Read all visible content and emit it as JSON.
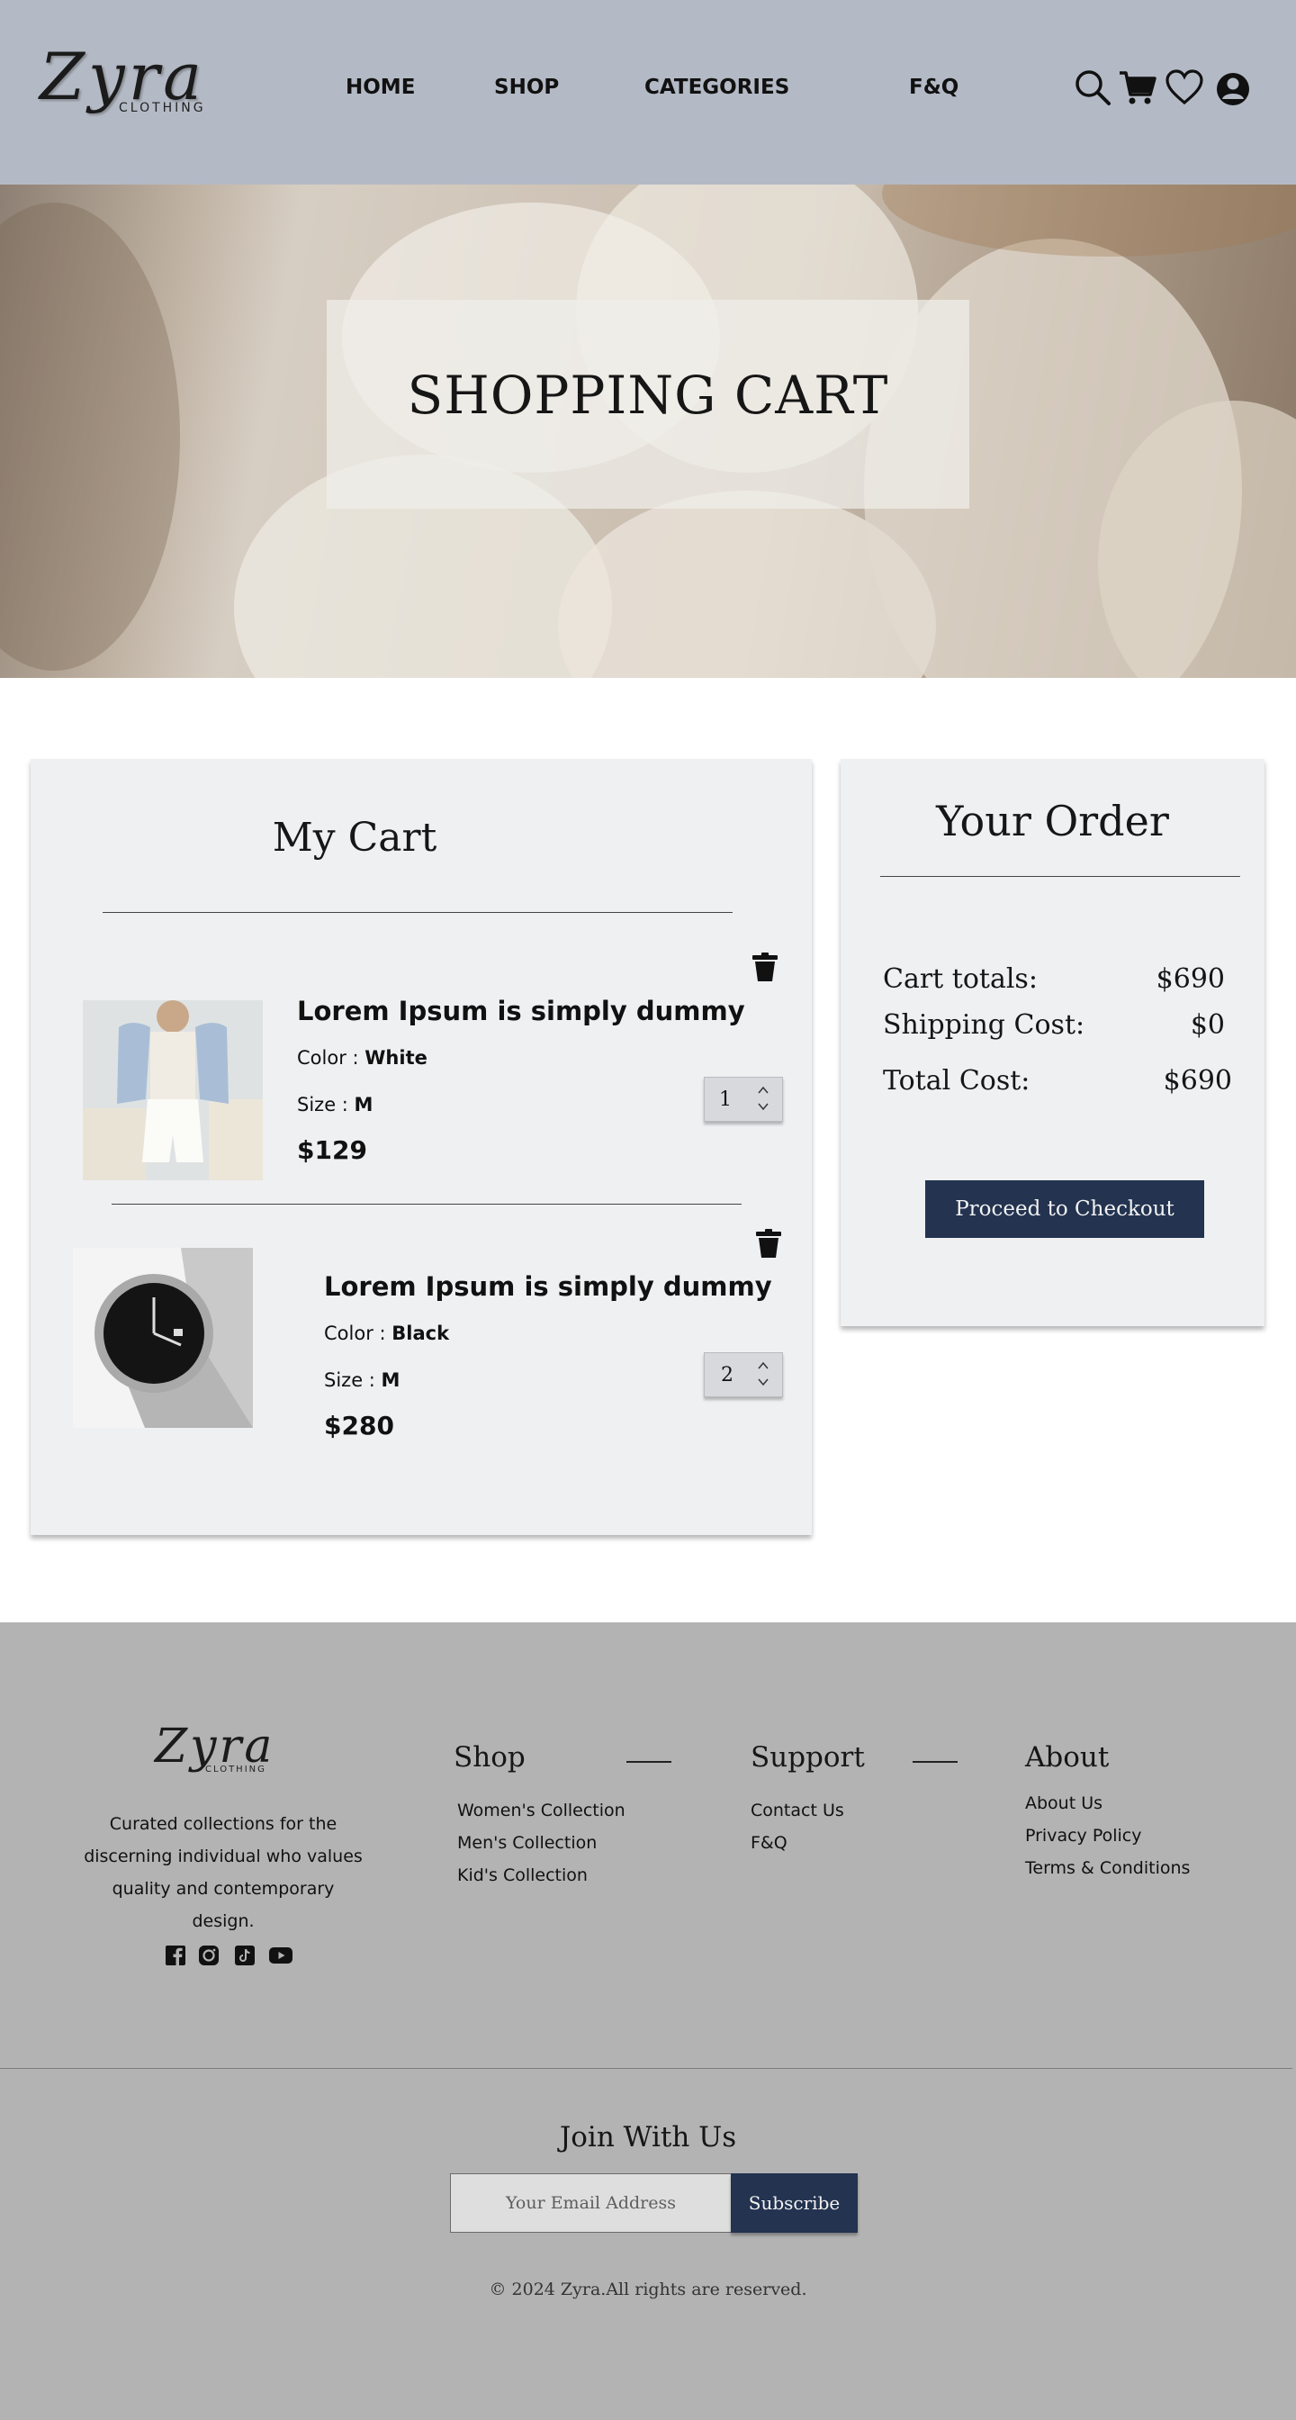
{
  "header": {
    "logo_script": "Zyra",
    "logo_sub": "CLOTHING",
    "nav": [
      "HOME",
      "SHOP",
      "CATEGORIES",
      "F&Q"
    ],
    "icons": [
      "search-icon",
      "cart-icon",
      "heart-icon",
      "user-icon"
    ]
  },
  "hero": {
    "title": "SHOPPING CART"
  },
  "cart": {
    "title": "My Cart",
    "items": [
      {
        "name": "Lorem Ipsum is simply dummy",
        "color_label": "Color : ",
        "color": "White",
        "size_label": "Size : ",
        "size": "M",
        "price": "$129",
        "qty": "1"
      },
      {
        "name": "Lorem Ipsum is simply dummy",
        "color_label": "Color : ",
        "color": "Black",
        "size_label": "Size : ",
        "size": "M",
        "price": "$280",
        "qty": "2"
      }
    ]
  },
  "order": {
    "title": "Your Order",
    "cart_totals_label": "Cart totals:",
    "cart_totals": "$690",
    "shipping_label": "Shipping Cost:",
    "shipping": "$0",
    "total_label": "Total Cost:",
    "total": "$690",
    "checkout": "Proceed to Checkout"
  },
  "footer": {
    "logo_script": "Zyra",
    "logo_sub": "CLOTHING",
    "tagline": "Curated collections for the discerning individual who values quality and contemporary design.",
    "social": [
      "facebook-icon",
      "instagram-icon",
      "tiktok-icon",
      "youtube-icon"
    ],
    "shop": {
      "title": "Shop",
      "links": [
        "Women's Collection",
        "Men's Collection",
        "Kid's Collection"
      ]
    },
    "support": {
      "title": "Support",
      "links": [
        "Contact Us",
        "F&Q"
      ]
    },
    "about": {
      "title": "About",
      "links": [
        "About Us",
        "Privacy Policy",
        "Terms & Conditions"
      ]
    },
    "join_title": "Join With Us",
    "email_placeholder": "Your Email Address",
    "subscribe": "Subscribe",
    "copyright": "© 2024 Zyra.All rights are  reserved."
  },
  "colors": {
    "header_bg": "#b4bac5",
    "panel_bg": "#eff0f2",
    "accent_navy": "#233350",
    "footer_bg": "#b3b3b3"
  }
}
